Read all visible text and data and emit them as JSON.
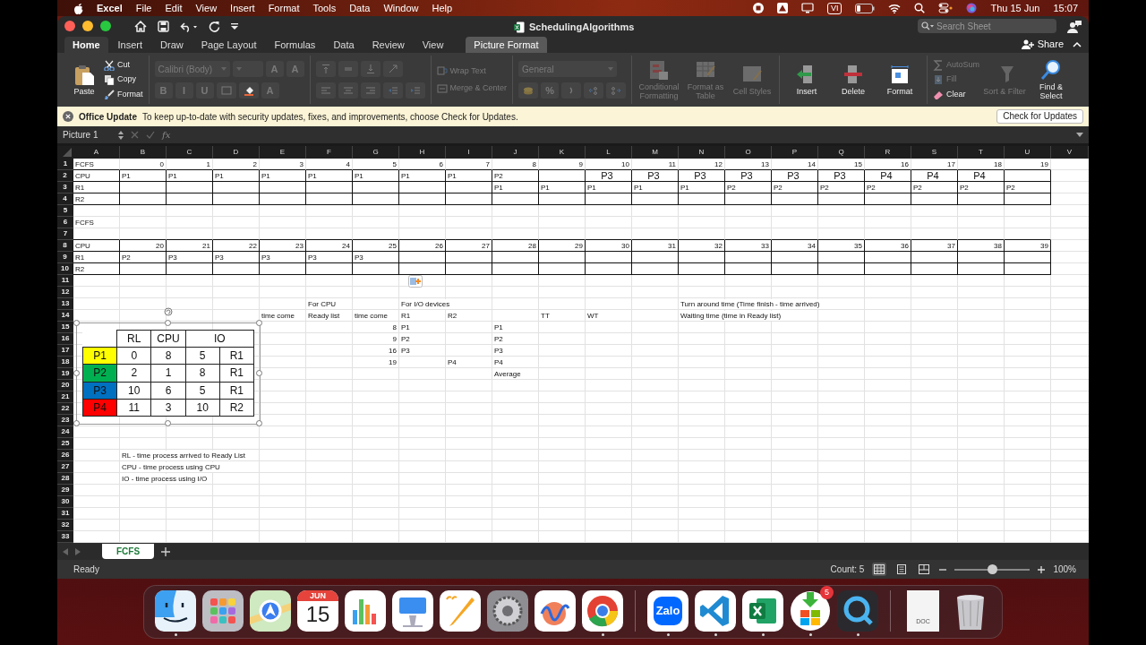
{
  "menu_bar": {
    "app": "Excel",
    "items": [
      "File",
      "Edit",
      "View",
      "Insert",
      "Format",
      "Tools",
      "Data",
      "Window",
      "Help"
    ],
    "input_source": "VI",
    "date": "Thu 15 Jun",
    "time": "15:07"
  },
  "window": {
    "title": "SchedulingAlgorithms",
    "search": {
      "placeholder": "Search Sheet"
    },
    "share": "Share"
  },
  "ribbon_tabs": [
    {
      "label": "Home",
      "selected": true,
      "kind": "standard"
    },
    {
      "label": "Insert",
      "selected": false,
      "kind": "standard"
    },
    {
      "label": "Draw",
      "selected": false,
      "kind": "standard"
    },
    {
      "label": "Page Layout",
      "selected": false,
      "kind": "standard"
    },
    {
      "label": "Formulas",
      "selected": false,
      "kind": "standard"
    },
    {
      "label": "Data",
      "selected": false,
      "kind": "standard"
    },
    {
      "label": "Review",
      "selected": false,
      "kind": "standard"
    },
    {
      "label": "View",
      "selected": false,
      "kind": "standard"
    },
    {
      "label": "Picture Format",
      "selected": false,
      "kind": "contextual"
    }
  ],
  "ribbon_groups": [
    {
      "kind": "clipboard",
      "paste": {
        "kind": "paste",
        "label": "Paste",
        "disabled": false
      },
      "small": [
        {
          "kind": "cut",
          "label": "Cut",
          "disabled": false
        },
        {
          "kind": "copy",
          "label": "Copy",
          "disabled": false
        },
        {
          "kind": "brush",
          "label": "Format",
          "disabled": false
        }
      ]
    },
    {
      "kind": "lines",
      "top": [
        {
          "kind": "combo",
          "label": "Calibri (Body)",
          "disabled": true
        },
        {
          "kind": "combo",
          "disabled": true
        },
        {
          "kind": "glyph",
          "label": "A",
          "disabled": true
        },
        {
          "kind": "glyph",
          "label": "A",
          "disabled": true
        }
      ],
      "bottom": [
        {
          "kind": "glyph",
          "label": "B",
          "disabled": true
        },
        {
          "kind": "glyph",
          "label": "I",
          "disabled": true
        },
        {
          "kind": "glyph",
          "label": "U",
          "disabled": true
        },
        {
          "kind": "border",
          "disabled": true
        },
        {
          "kind": "fill",
          "disabled": false
        },
        {
          "kind": "glyph",
          "label": "A",
          "disabled": true
        }
      ]
    },
    {
      "kind": "lines",
      "top": [
        {
          "kind": "align-top",
          "disabled": true
        },
        {
          "kind": "align-middle",
          "disabled": true
        },
        {
          "kind": "align-bottom",
          "disabled": true
        },
        {
          "kind": "orientation",
          "disabled": true
        }
      ],
      "bottom": [
        {
          "kind": "align-left",
          "disabled": true
        },
        {
          "kind": "align-center",
          "disabled": true
        },
        {
          "kind": "align-right",
          "disabled": true
        },
        {
          "kind": "indent-less",
          "disabled": true
        },
        {
          "kind": "indent-more",
          "disabled": true
        }
      ]
    },
    {
      "kind": "lines",
      "top": [
        {
          "kind": "wrap",
          "label": "Wrap Text",
          "disabled": true
        }
      ],
      "bottom": [
        {
          "kind": "merge",
          "label": "Merge & Center",
          "disabled": true
        }
      ]
    },
    {
      "kind": "lines",
      "top": [
        {
          "kind": "combo",
          "label": "General",
          "disabled": true
        }
      ],
      "bottom": [
        {
          "kind": "currency",
          "disabled": true
        },
        {
          "kind": "glyph",
          "label": "%",
          "disabled": true
        },
        {
          "kind": "comma",
          "disabled": true
        },
        {
          "kind": "decimal-more",
          "disabled": true
        },
        {
          "kind": "decimal-less",
          "disabled": true
        }
      ]
    },
    {
      "kind": "bigs",
      "items": [
        {
          "kind": "conditional",
          "label": "Conditional Formatting",
          "disabled": true
        },
        {
          "kind": "table",
          "label": "Format as Table",
          "disabled": true
        },
        {
          "kind": "styles",
          "label": "Cell Styles",
          "disabled": true
        }
      ]
    },
    {
      "kind": "bigs",
      "items": [
        {
          "kind": "insert",
          "label": "Insert",
          "disabled": false
        },
        {
          "kind": "delete",
          "label": "Delete",
          "disabled": false
        },
        {
          "kind": "format",
          "label": "Format",
          "disabled": false
        }
      ]
    },
    {
      "kind": "editing",
      "small": [
        {
          "kind": "sum",
          "label": "AutoSum",
          "disabled": true
        },
        {
          "kind": "fill-down",
          "label": "Fill",
          "disabled": true
        },
        {
          "kind": "eraser",
          "label": "Clear",
          "disabled": false
        }
      ],
      "items": [
        {
          "kind": "sort",
          "label": "Sort & Filter",
          "disabled": true
        },
        {
          "kind": "find",
          "label": "Find & Select",
          "disabled": false
        }
      ]
    }
  ],
  "update_bar": {
    "title": "Office Update",
    "message": "To keep up-to-date with security updates, fixes, and improvements, choose Check for Updates.",
    "button": "Check for Updates"
  },
  "formula_bar": {
    "name_box": "Picture 1",
    "function_label": "fx"
  },
  "sheet": {
    "columns": [
      "A",
      "B",
      "C",
      "D",
      "E",
      "F",
      "G",
      "H",
      "I",
      "J",
      "K",
      "L",
      "M",
      "N",
      "O",
      "P",
      "Q",
      "R",
      "S",
      "T",
      "U",
      "V"
    ],
    "rows": [
      {
        "number": "1",
        "bordered": false,
        "cells": [
          {
            "text": "FCFS",
            "kind": "text"
          },
          {
            "text": "0",
            "kind": "number"
          },
          {
            "text": "1",
            "kind": "number"
          },
          {
            "text": "2",
            "kind": "number"
          },
          {
            "text": "3",
            "kind": "number"
          },
          {
            "text": "4",
            "kind": "number"
          },
          {
            "text": "5",
            "kind": "number"
          },
          {
            "text": "6",
            "kind": "number"
          },
          {
            "text": "7",
            "kind": "number"
          },
          {
            "text": "8",
            "kind": "number"
          },
          {
            "text": "9",
            "kind": "number"
          },
          {
            "text": "10",
            "kind": "number"
          },
          {
            "text": "11",
            "kind": "number"
          },
          {
            "text": "12",
            "kind": "number"
          },
          {
            "text": "13",
            "kind": "number"
          },
          {
            "text": "14",
            "kind": "number"
          },
          {
            "text": "15",
            "kind": "number"
          },
          {
            "text": "16",
            "kind": "number"
          },
          {
            "text": "17",
            "kind": "number"
          },
          {
            "text": "18",
            "kind": "number"
          },
          {
            "text": "19",
            "kind": "number"
          }
        ]
      },
      {
        "number": "2",
        "bordered": true,
        "cells": [
          {
            "text": "CPU",
            "kind": "text"
          },
          {
            "text": "P1",
            "kind": "text"
          },
          {
            "text": "P1",
            "kind": "text"
          },
          {
            "text": "P1",
            "kind": "text"
          },
          {
            "text": "P1",
            "kind": "text"
          },
          {
            "text": "P1",
            "kind": "text"
          },
          {
            "text": "P1",
            "kind": "text"
          },
          {
            "text": "P1",
            "kind": "text"
          },
          {
            "text": "P1",
            "kind": "text"
          },
          {
            "text": "P2",
            "kind": "text"
          },
          "",
          {
            "text": "P3",
            "kind": "big"
          },
          {
            "text": "P3",
            "kind": "big"
          },
          {
            "text": "P3",
            "kind": "big"
          },
          {
            "text": "P3",
            "kind": "big"
          },
          {
            "text": "P3",
            "kind": "big"
          },
          {
            "text": "P3",
            "kind": "big"
          },
          {
            "text": "P4",
            "kind": "big"
          },
          {
            "text": "P4",
            "kind": "big"
          },
          {
            "text": "P4",
            "kind": "big"
          }
        ]
      },
      {
        "number": "3",
        "bordered": true,
        "cells": [
          {
            "text": "R1",
            "kind": "text"
          },
          "",
          "",
          "",
          "",
          "",
          "",
          "",
          "",
          {
            "text": "P1",
            "kind": "text"
          },
          {
            "text": "P1",
            "kind": "text"
          },
          {
            "text": "P1",
            "kind": "text"
          },
          {
            "text": "P1",
            "kind": "text"
          },
          {
            "text": "P1",
            "kind": "text"
          },
          {
            "text": "P2",
            "kind": "text"
          },
          {
            "text": "P2",
            "kind": "text"
          },
          {
            "text": "P2",
            "kind": "text"
          },
          {
            "text": "P2",
            "kind": "text"
          },
          {
            "text": "P2",
            "kind": "text"
          },
          {
            "text": "P2",
            "kind": "text"
          },
          {
            "text": "P2",
            "kind": "text"
          }
        ]
      },
      {
        "number": "4",
        "bordered": true,
        "cells": [
          {
            "text": "R2",
            "kind": "text"
          }
        ]
      },
      {
        "number": "5",
        "bordered": false
      },
      {
        "number": "6",
        "bordered": false,
        "cells": [
          {
            "text": "FCFS",
            "kind": "text"
          }
        ]
      },
      {
        "number": "7",
        "bordered": false
      },
      {
        "number": "8",
        "bordered": true,
        "cells": [
          {
            "text": "CPU",
            "kind": "text"
          },
          {
            "text": "20",
            "kind": "number"
          },
          {
            "text": "21",
            "kind": "number"
          },
          {
            "text": "22",
            "kind": "number"
          },
          {
            "text": "23",
            "kind": "number"
          },
          {
            "text": "24",
            "kind": "number"
          },
          {
            "text": "25",
            "kind": "number"
          },
          {
            "text": "26",
            "kind": "number"
          },
          {
            "text": "27",
            "kind": "number"
          },
          {
            "text": "28",
            "kind": "number"
          },
          {
            "text": "29",
            "kind": "number"
          },
          {
            "text": "30",
            "kind": "number"
          },
          {
            "text": "31",
            "kind": "number"
          },
          {
            "text": "32",
            "kind": "number"
          },
          {
            "text": "33",
            "kind": "number"
          },
          {
            "text": "34",
            "kind": "number"
          },
          {
            "text": "35",
            "kind": "number"
          },
          {
            "text": "36",
            "kind": "number"
          },
          {
            "text": "37",
            "kind": "number"
          },
          {
            "text": "38",
            "kind": "number"
          },
          {
            "text": "39",
            "kind": "number"
          }
        ]
      },
      {
        "number": "9",
        "bordered": true,
        "cells": [
          {
            "text": "R1",
            "kind": "text"
          },
          {
            "text": "P2",
            "kind": "text"
          },
          {
            "text": "P3",
            "kind": "text"
          },
          {
            "text": "P3",
            "kind": "text"
          },
          {
            "text": "P3",
            "kind": "text"
          },
          {
            "text": "P3",
            "kind": "text"
          },
          {
            "text": "P3",
            "kind": "text"
          }
        ]
      },
      {
        "number": "10",
        "bordered": true,
        "cells": [
          {
            "text": "R2",
            "kind": "text"
          }
        ]
      },
      {
        "number": "11",
        "bordered": false
      },
      {
        "number": "12",
        "bordered": false
      },
      {
        "number": "13",
        "bordered": false,
        "cells": [
          "",
          "",
          "",
          "",
          "",
          {
            "text": "For CPU",
            "kind": "text"
          },
          "",
          {
            "text": "For I/O devices",
            "kind": "text"
          },
          "",
          "",
          "",
          "",
          "",
          {
            "text": "Turn around time (Time finish - time arrived)",
            "kind": "text"
          }
        ]
      },
      {
        "number": "14",
        "bordered": false,
        "cells": [
          "",
          "",
          "",
          "",
          {
            "text": "time come",
            "kind": "text"
          },
          {
            "text": "Ready list",
            "kind": "text"
          },
          {
            "text": "time come",
            "kind": "text"
          },
          {
            "text": "R1",
            "kind": "text"
          },
          {
            "text": "R2",
            "kind": "text"
          },
          "",
          {
            "text": "TT",
            "kind": "text"
          },
          {
            "text": "WT",
            "kind": "text"
          },
          "",
          {
            "text": "Waiting time (time in Ready list)",
            "kind": "text"
          }
        ]
      },
      {
        "number": "15",
        "bordered": false,
        "cells": [
          "",
          "",
          "",
          "",
          "",
          "",
          {
            "text": "8",
            "kind": "number"
          },
          {
            "text": "P1",
            "kind": "text"
          },
          "",
          {
            "text": "P1",
            "kind": "text"
          }
        ]
      },
      {
        "number": "16",
        "bordered": false,
        "cells": [
          "",
          "",
          "",
          "",
          "",
          "",
          {
            "text": "9",
            "kind": "number"
          },
          {
            "text": "P2",
            "kind": "text"
          },
          "",
          {
            "text": "P2",
            "kind": "text"
          }
        ]
      },
      {
        "number": "17",
        "bordered": false,
        "cells": [
          "",
          "",
          "",
          "",
          "",
          "",
          {
            "text": "16",
            "kind": "number"
          },
          {
            "text": "P3",
            "kind": "text"
          },
          "",
          {
            "text": "P3",
            "kind": "text"
          }
        ]
      },
      {
        "number": "18",
        "bordered": false,
        "cells": [
          "",
          "",
          "",
          "",
          "",
          "",
          {
            "text": "19",
            "kind": "number"
          },
          "",
          {
            "text": "P4",
            "kind": "text"
          },
          {
            "text": "P4",
            "kind": "text"
          }
        ]
      },
      {
        "number": "19",
        "bordered": false,
        "cells": [
          "",
          "",
          "",
          "",
          "",
          "",
          "",
          "",
          "",
          {
            "text": "Average",
            "kind": "text"
          }
        ]
      },
      {
        "number": "20",
        "bordered": false
      },
      {
        "number": "21",
        "bordered": false
      },
      {
        "number": "22",
        "bordered": false
      },
      {
        "number": "23",
        "bordered": false
      },
      {
        "number": "24",
        "bordered": false
      },
      {
        "number": "25",
        "bordered": false
      },
      {
        "number": "26",
        "bordered": false,
        "cells": [
          "",
          {
            "text": "RL - time process arrived to Ready List",
            "kind": "text"
          }
        ]
      },
      {
        "number": "27",
        "bordered": false,
        "cells": [
          "",
          {
            "text": "CPU - time process using CPU",
            "kind": "text"
          }
        ]
      },
      {
        "number": "28",
        "bordered": false,
        "cells": [
          "",
          {
            "text": "IO - time process using I/O",
            "kind": "text"
          }
        ]
      },
      {
        "number": "29",
        "bordered": false
      },
      {
        "number": "30",
        "bordered": false
      },
      {
        "number": "31",
        "bordered": false
      },
      {
        "number": "32",
        "bordered": false
      },
      {
        "number": "33",
        "bordered": false
      }
    ]
  },
  "picture_table": {
    "selected": true,
    "header": [
      "RL",
      "CPU",
      "IO"
    ],
    "rows": [
      {
        "label": "P1",
        "color": "#ffff00",
        "values": [
          "0",
          "8",
          "5",
          "R1"
        ]
      },
      {
        "label": "P2",
        "color": "#00b050",
        "values": [
          "2",
          "1",
          "8",
          "R1"
        ]
      },
      {
        "label": "P3",
        "color": "#0070c0",
        "values": [
          "10",
          "6",
          "5",
          "R1"
        ]
      },
      {
        "label": "P4",
        "color": "#ff0000",
        "values": [
          "11",
          "3",
          "10",
          "R2"
        ]
      }
    ]
  },
  "sheet_tabs": [
    {
      "label": "FCFS",
      "selected": true
    }
  ],
  "status_bar": {
    "mode": "Ready",
    "count": "Count: 5",
    "views": [
      {
        "kind": "normal",
        "selected": true
      },
      {
        "kind": "page-layout",
        "selected": false
      },
      {
        "kind": "page-break",
        "selected": false
      }
    ],
    "zoom_slider": {
      "level": 0.5
    },
    "zoom": "100%"
  },
  "dock": [
    {
      "kind": "finder",
      "running": true
    },
    {
      "kind": "launchpad",
      "running": false
    },
    {
      "kind": "maps",
      "running": false
    },
    {
      "kind": "calendar",
      "month": "JUN",
      "day": "15",
      "running": false
    },
    {
      "kind": "numbers",
      "running": false
    },
    {
      "kind": "keynote",
      "running": false
    },
    {
      "kind": "pages",
      "running": false
    },
    {
      "kind": "settings",
      "running": false
    },
    {
      "kind": "freeform",
      "running": false
    },
    {
      "kind": "chrome",
      "running": true
    },
    {
      "kind": "separator"
    },
    {
      "kind": "zalo",
      "label": "Zalo",
      "running": true
    },
    {
      "kind": "vscode",
      "running": true
    },
    {
      "kind": "excel",
      "running": true
    },
    {
      "kind": "store",
      "badge": "5",
      "running": true
    },
    {
      "kind": "quicktime",
      "running": true
    },
    {
      "kind": "separator"
    },
    {
      "kind": "document",
      "label": "DOC",
      "running": false
    },
    {
      "kind": "trash",
      "running": false
    }
  ]
}
